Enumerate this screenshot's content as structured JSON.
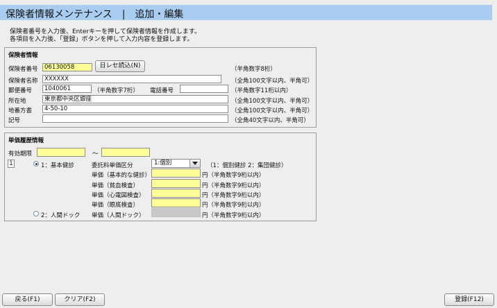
{
  "title": "保険者情報メンテナンス　|　追加・編集",
  "intro": {
    "line1": "保険者番号を入力後、Enterキーを押して保険者情報を作成します。",
    "line2": "各項目を入力後、「登録」ボタンを押して入力内容を登録します。"
  },
  "insurer": {
    "section_title": "保険者情報",
    "number_label": "保険者番号",
    "number_value": "06130058",
    "receipt_button": "日レセ読込(N)",
    "number_hint": "（半角数字8桁）",
    "name_label": "保険者名称",
    "name_value": "XXXXXX",
    "name_hint": "（全角100文字以内、半角可）",
    "zip_label": "郵便番号",
    "zip_value": "1040061",
    "zip_hint": "（半角数字7桁）",
    "phone_label": "電話番号",
    "phone_value": "",
    "phone_hint": "（半角数字11桁以内）",
    "address_label": "所在地",
    "address_value": "東京都中央区銀座",
    "address_hint": "（全角100文字以内、半角可）",
    "block_label": "地番方書",
    "block_value": "4-50-10",
    "block_hint": "（全角100文字以内、半角可）",
    "note_label": "記号",
    "note_value": "",
    "note_hint": "（全角40文字以内、半角可）"
  },
  "price": {
    "section_title": "単価履歴情報",
    "period_label": "有効期限",
    "period_from": "",
    "tilde": "～",
    "period_to": "",
    "row_index": "1",
    "option1_label": "1：基本健診",
    "option1_selected": true,
    "category_label": "委託料単価区分",
    "category_value": "1:個別",
    "category_hint": "（1：個別健診 2：集団健診）",
    "rows": [
      {
        "label": "単価（基本的な健診）",
        "value": "",
        "unit": "円（半角数字9桁以内）"
      },
      {
        "label": "単価（貧血検査）",
        "value": "",
        "unit": "円（半角数字9桁以内）"
      },
      {
        "label": "単価（心電図検査）",
        "value": "",
        "unit": "円（半角数字9桁以内）"
      },
      {
        "label": "単価（眼底検査）",
        "value": "",
        "unit": "円（半角数字9桁以内）"
      }
    ],
    "option2_label": "2：人間ドック",
    "option2_selected": false,
    "dock_label": "単価（人間ドック）",
    "dock_value": "",
    "dock_unit": "円（半角数字9桁以内）"
  },
  "footer": {
    "back_button": "戻る(F1)",
    "clear_button": "クリア(F2)",
    "register_button": "登録(F12)"
  }
}
